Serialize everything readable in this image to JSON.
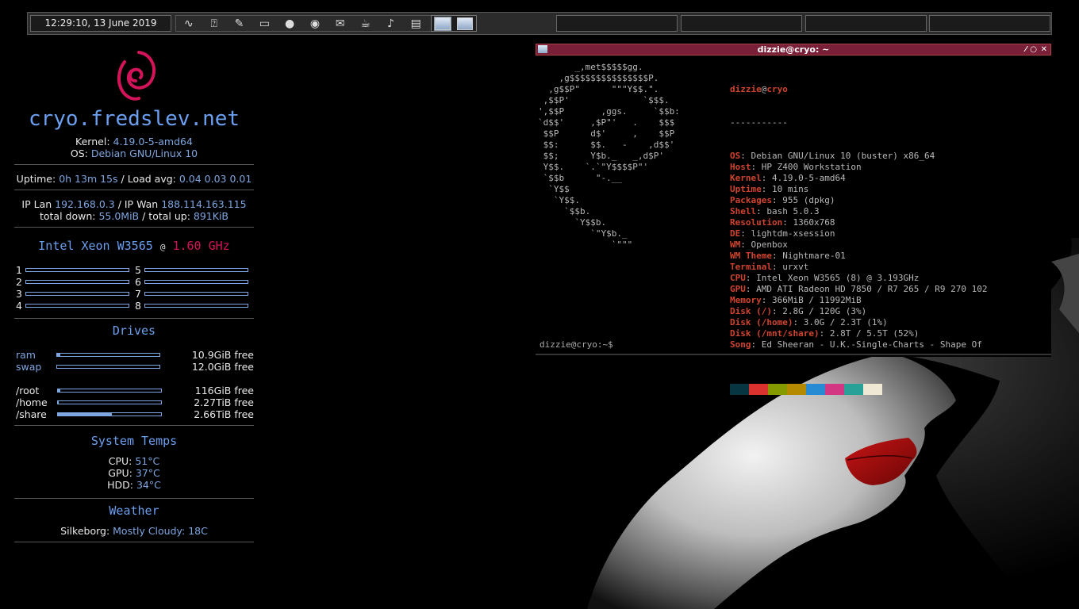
{
  "panel": {
    "clock": "12:29:10,  13 June 2019",
    "launchers": [
      {
        "icon": "system-monitor-icon",
        "glyph": "∿"
      },
      {
        "icon": "network-icon",
        "glyph": "⍰"
      },
      {
        "icon": "pencil-icon",
        "glyph": "✎"
      },
      {
        "icon": "monitor-icon",
        "glyph": "▭"
      },
      {
        "icon": "chat-icon",
        "glyph": "●"
      },
      {
        "icon": "chrome-icon",
        "glyph": "◉"
      },
      {
        "icon": "mail-icon",
        "glyph": "✉"
      },
      {
        "icon": "teapot-icon",
        "glyph": "☕"
      },
      {
        "icon": "volume-icon",
        "glyph": "♪"
      },
      {
        "icon": "clapperboard-icon",
        "glyph": "▤"
      },
      {
        "icon": "music-icon",
        "glyph": "♫"
      }
    ]
  },
  "conky": {
    "hostname": "cryo.fredslev.net",
    "kernel_label": "Kernel:",
    "kernel": "4.19.0-5-amd64",
    "os_label": "OS:",
    "os": "Debian GNU/Linux 10",
    "uptime_label": "Uptime:",
    "uptime": "0h 13m 15s",
    "load_label": "/ Load avg:",
    "load": "0.04 0.03 0.01",
    "iplan_label": "IP Lan",
    "iplan": "192.168.0.3",
    "ipwan_label": "/ IP Wan",
    "ipwan": "188.114.163.115",
    "down_label": "total down:",
    "down": "55.0MiB",
    "up_label": "/ total up:",
    "up": "891KiB",
    "cpu_name": "Intel Xeon W3565",
    "cpu_at": "@",
    "cpu_freq": "1.60 GHz",
    "cores": [
      {
        "num": "1",
        "load": 0.0
      },
      {
        "num": "2",
        "load": 0.0
      },
      {
        "num": "3",
        "load": 0.0
      },
      {
        "num": "4",
        "load": 0.0
      },
      {
        "num": "5",
        "load": 0.0
      },
      {
        "num": "6",
        "load": 0.0
      },
      {
        "num": "7",
        "load": 0.0
      },
      {
        "num": "8",
        "load": 0.0
      }
    ],
    "drives_title": "Drives",
    "mem": [
      {
        "label": "ram",
        "free": "10.9GiB free",
        "used": 0.03
      },
      {
        "label": "swap",
        "free": "12.0GiB free",
        "used": 0.0
      }
    ],
    "disks": [
      {
        "label": "/root",
        "free": "116GiB free",
        "used": 0.02
      },
      {
        "label": "/home",
        "free": "2.27TiB free",
        "used": 0.01
      },
      {
        "label": "/share",
        "free": "2.66TiB free",
        "used": 0.52
      }
    ],
    "temps_title": "System Temps",
    "temps": [
      {
        "label": "CPU:",
        "value": "51°C"
      },
      {
        "label": "GPU:",
        "value": "37°C"
      },
      {
        "label": "HDD:",
        "value": "34°C"
      }
    ],
    "weather_title": "Weather",
    "weather_place": "Silkeborg:",
    "weather": "Mostly Cloudy: 18C"
  },
  "terminal": {
    "title": "dizzie@cryo: ~",
    "ascii": [
      "       _,met$$$$$gg.",
      "    ,g$$$$$$$$$$$$$$$P.",
      "  ,g$$P\"      \"\"\"Y$$.\".",
      " ,$$P'              `$$$.",
      "',$$P       ,ggs.     `$$b:",
      "`d$$'     ,$P\"'   .    $$$",
      " $$P      d$'     ,    $$P",
      " $$:      $$.   -    ,d$$'",
      " $$;      Y$b._   _,d$P'",
      " Y$$.    `.`\"Y$$$$P\"'",
      " `$$b      \"-.__",
      "  `Y$$",
      "   `Y$$.",
      "     `$$b.",
      "       `Y$$b.",
      "          `\"Y$b._",
      "              `\"\"\""
    ],
    "user": "dizzie",
    "at": "@",
    "host": "cryo",
    "separator": "-----------",
    "info": [
      {
        "key": "OS",
        "value": "Debian GNU/Linux 10 (buster) x86_64"
      },
      {
        "key": "Host",
        "value": "HP Z400 Workstation"
      },
      {
        "key": "Kernel",
        "value": "4.19.0-5-amd64"
      },
      {
        "key": "Uptime",
        "value": "10 mins"
      },
      {
        "key": "Packages",
        "value": "955 (dpkg)"
      },
      {
        "key": "Shell",
        "value": "bash 5.0.3"
      },
      {
        "key": "Resolution",
        "value": "1360x768"
      },
      {
        "key": "DE",
        "value": "lightdm-xsession"
      },
      {
        "key": "WM",
        "value": "Openbox"
      },
      {
        "key": "WM Theme",
        "value": "Nightmare-01"
      },
      {
        "key": "Terminal",
        "value": "urxvt"
      },
      {
        "key": "CPU",
        "value": "Intel Xeon W3565 (8) @ 3.193GHz"
      },
      {
        "key": "GPU",
        "value": "AMD ATI Radeon HD 7850 / R7 265 / R9 270 102"
      },
      {
        "key": "Memory",
        "value": "366MiB / 11992MiB"
      },
      {
        "key": "Disk (/)",
        "value": "2.8G / 120G (3%)"
      },
      {
        "key": "Disk (/home)",
        "value": "3.0G / 2.3T (1%)"
      },
      {
        "key": "Disk (/mnt/share)",
        "value": "2.8T / 5.5T (52%)"
      },
      {
        "key": "Song",
        "value": "Ed Sheeran - U.K.-Single-Charts - Shape Of"
      }
    ],
    "colors": [
      "#073642",
      "#dc322f",
      "#859900",
      "#b58900",
      "#268bd2",
      "#d33682",
      "#2aa198",
      "#eee8d5"
    ],
    "prompt": "dizzie@cryo:~$"
  }
}
